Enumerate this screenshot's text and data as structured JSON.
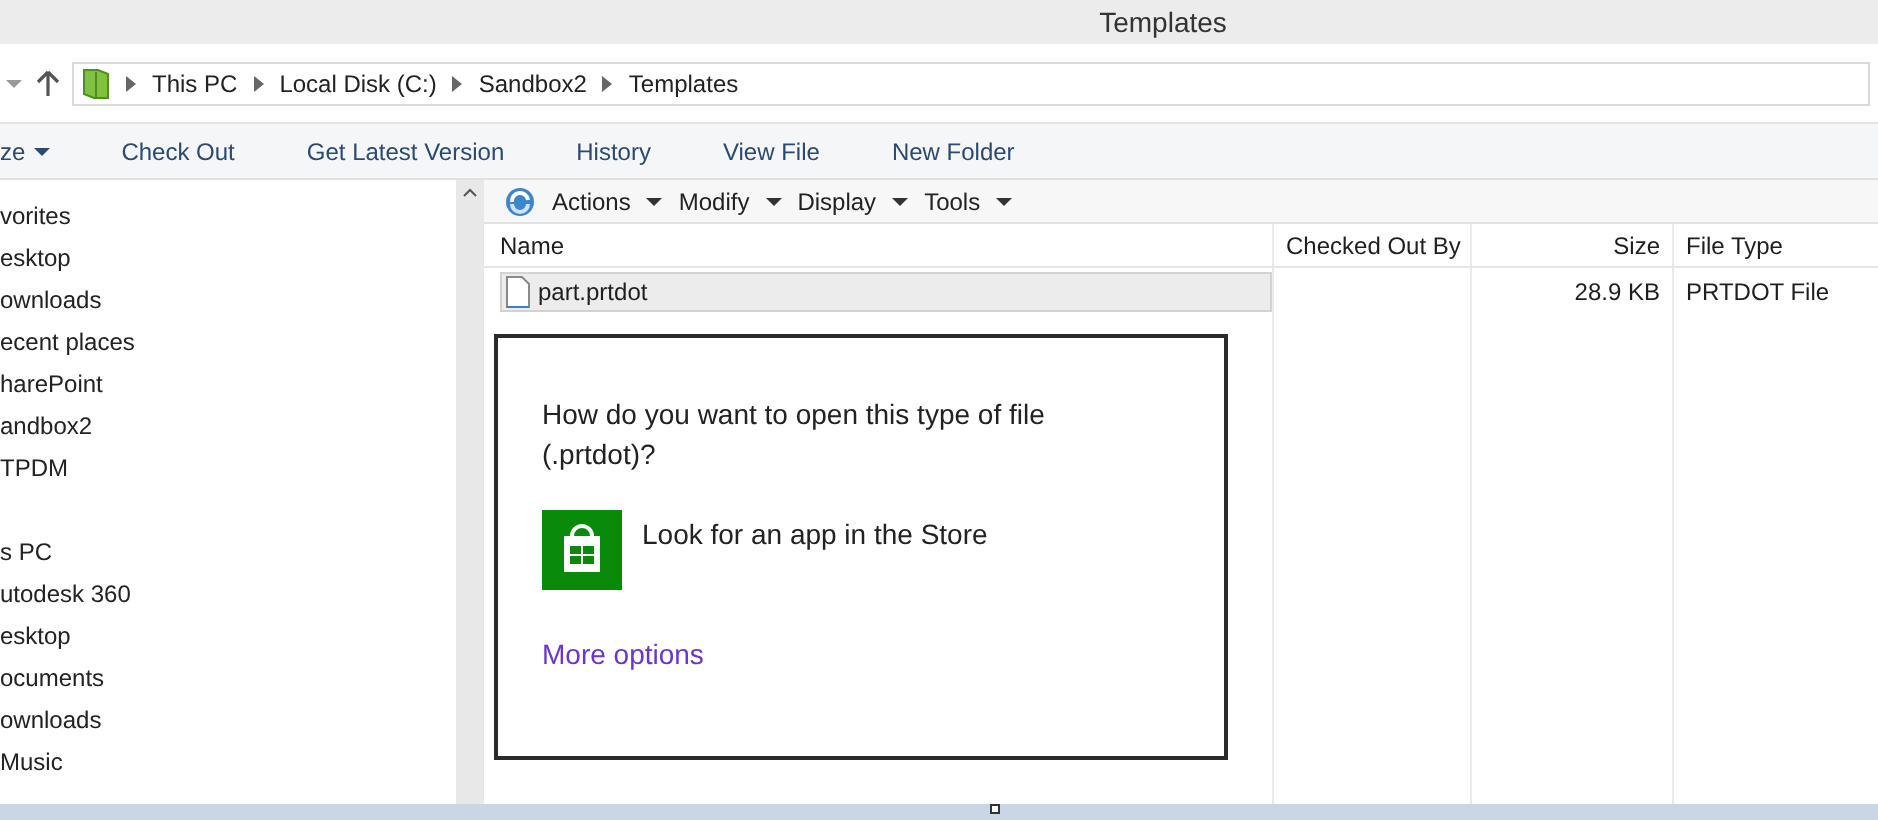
{
  "window": {
    "title": "Templates"
  },
  "breadcrumb": [
    "This PC",
    "Local Disk (C:)",
    "Sandbox2",
    "Templates"
  ],
  "ribbon": [
    {
      "label": "ze",
      "dropdown": true
    },
    {
      "label": "Check Out",
      "dropdown": false
    },
    {
      "label": "Get Latest Version",
      "dropdown": false
    },
    {
      "label": "History",
      "dropdown": false
    },
    {
      "label": "View File",
      "dropdown": false
    },
    {
      "label": "New Folder",
      "dropdown": false
    }
  ],
  "sidebar": {
    "groups": [
      {
        "items": [
          "vorites",
          "esktop",
          "ownloads",
          "ecent places",
          "harePoint",
          "andbox2",
          "TPDM"
        ]
      },
      {
        "items": [
          "s PC",
          "utodesk 360",
          "esktop",
          "ocuments",
          "ownloads",
          "Music"
        ]
      }
    ]
  },
  "pdm_toolbar": [
    "Actions",
    "Modify",
    "Display",
    "Tools"
  ],
  "table": {
    "columns": [
      "Name",
      "Checked Out By",
      "Size",
      "File Type"
    ],
    "rows": [
      {
        "cells": [
          "part.prtdot",
          "",
          "28.9 KB",
          "PRTDOT File"
        ],
        "selected": true
      }
    ]
  },
  "dialog": {
    "question": "How do you want to open this type of file (.prtdot)?",
    "option": "Look for an app in the Store",
    "link": "More options"
  }
}
